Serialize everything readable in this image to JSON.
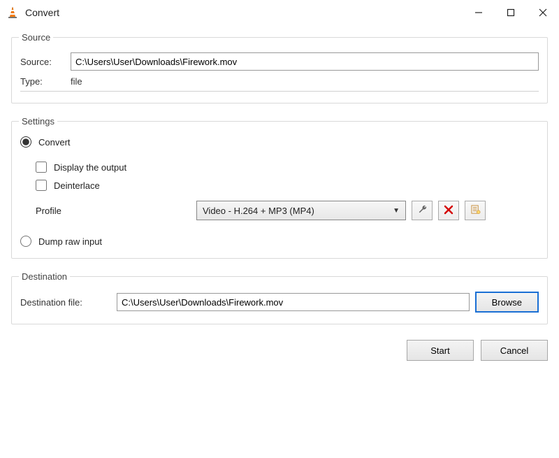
{
  "window": {
    "title": "Convert"
  },
  "source_group": {
    "legend": "Source",
    "source_label": "Source:",
    "source_value": "C:\\Users\\User\\Downloads\\Firework.mov",
    "type_label": "Type:",
    "type_value": "file"
  },
  "settings_group": {
    "legend": "Settings",
    "convert_label": "Convert",
    "display_output_label": "Display the output",
    "deinterlace_label": "Deinterlace",
    "profile_label": "Profile",
    "profile_value": "Video - H.264 + MP3 (MP4)",
    "dump_raw_label": "Dump raw input"
  },
  "destination_group": {
    "legend": "Destination",
    "dest_label": "Destination file:",
    "dest_value": "C:\\Users\\User\\Downloads\\Firework.mov",
    "browse_label": "Browse"
  },
  "footer": {
    "start_label": "Start",
    "cancel_label": "Cancel"
  }
}
